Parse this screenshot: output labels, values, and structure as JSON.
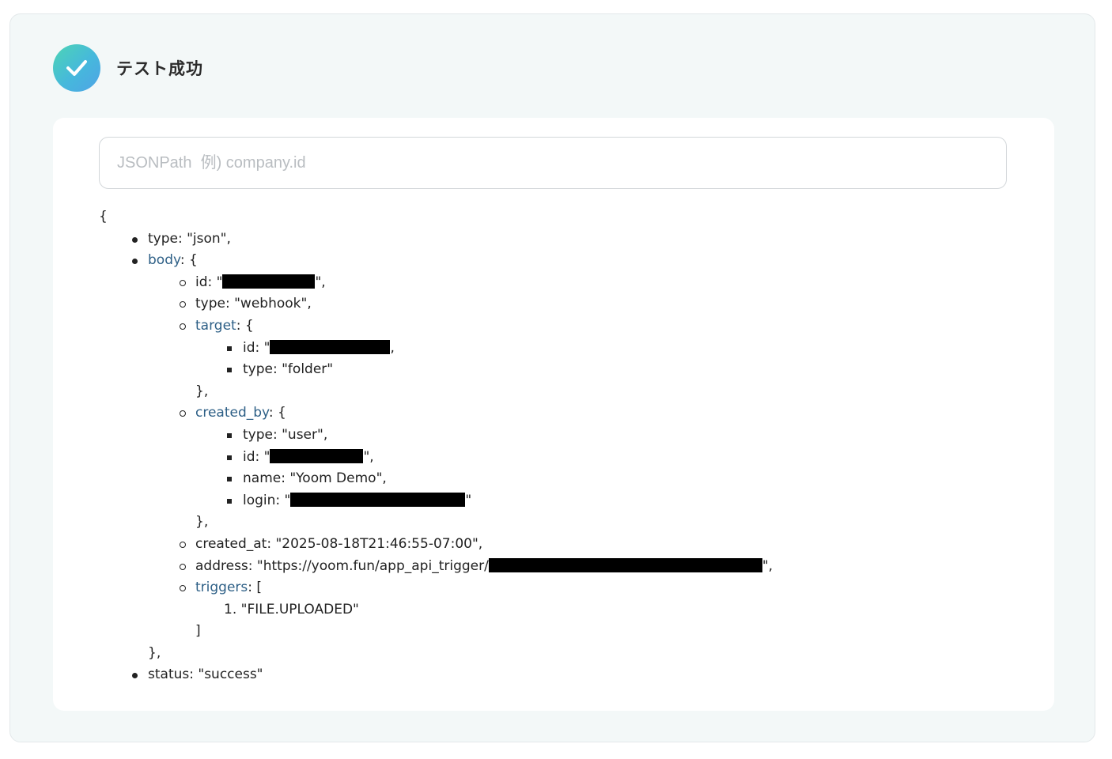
{
  "status": {
    "title": "テスト成功",
    "icon": "check-icon",
    "accent": "#46b8dc"
  },
  "jsonpath": {
    "placeholder": "JSONPath  例) company.id",
    "value": ""
  },
  "tree": {
    "open": "{",
    "type_line": "type: \"json\",",
    "body_key": "body",
    "body_open": ": {",
    "id_prefix": "id: \"",
    "id_suffix": "\",",
    "webhook_type": "type: \"webhook\",",
    "target_key": "target",
    "target_open": ": {",
    "target_id_prefix": "id: \"",
    "target_id_suffix": ",",
    "target_type": "type: \"folder\"",
    "target_close": "},",
    "created_by_key": "created_by",
    "created_by_open": ": {",
    "user_type": "type: \"user\",",
    "user_id_prefix": "id: \"",
    "user_id_suffix": "\",",
    "user_name": "name: \"Yoom Demo\",",
    "login_prefix": "login: \"",
    "login_suffix": "\"",
    "created_by_close": "},",
    "created_at": "created_at: \"2025-08-18T21:46:55-07:00\",",
    "address_prefix": "address: \"https://yoom.fun/app_api_trigger/",
    "address_suffix": "\",",
    "triggers_key": "triggers",
    "triggers_open": ": [",
    "trigger_item": "1. \"FILE.UPLOADED\"",
    "triggers_close": "]",
    "body_close": "},",
    "status_line": "status: \"success\""
  },
  "colors": {
    "link_key": "#2d5f86",
    "panel_bg": "#f3f8f8"
  }
}
